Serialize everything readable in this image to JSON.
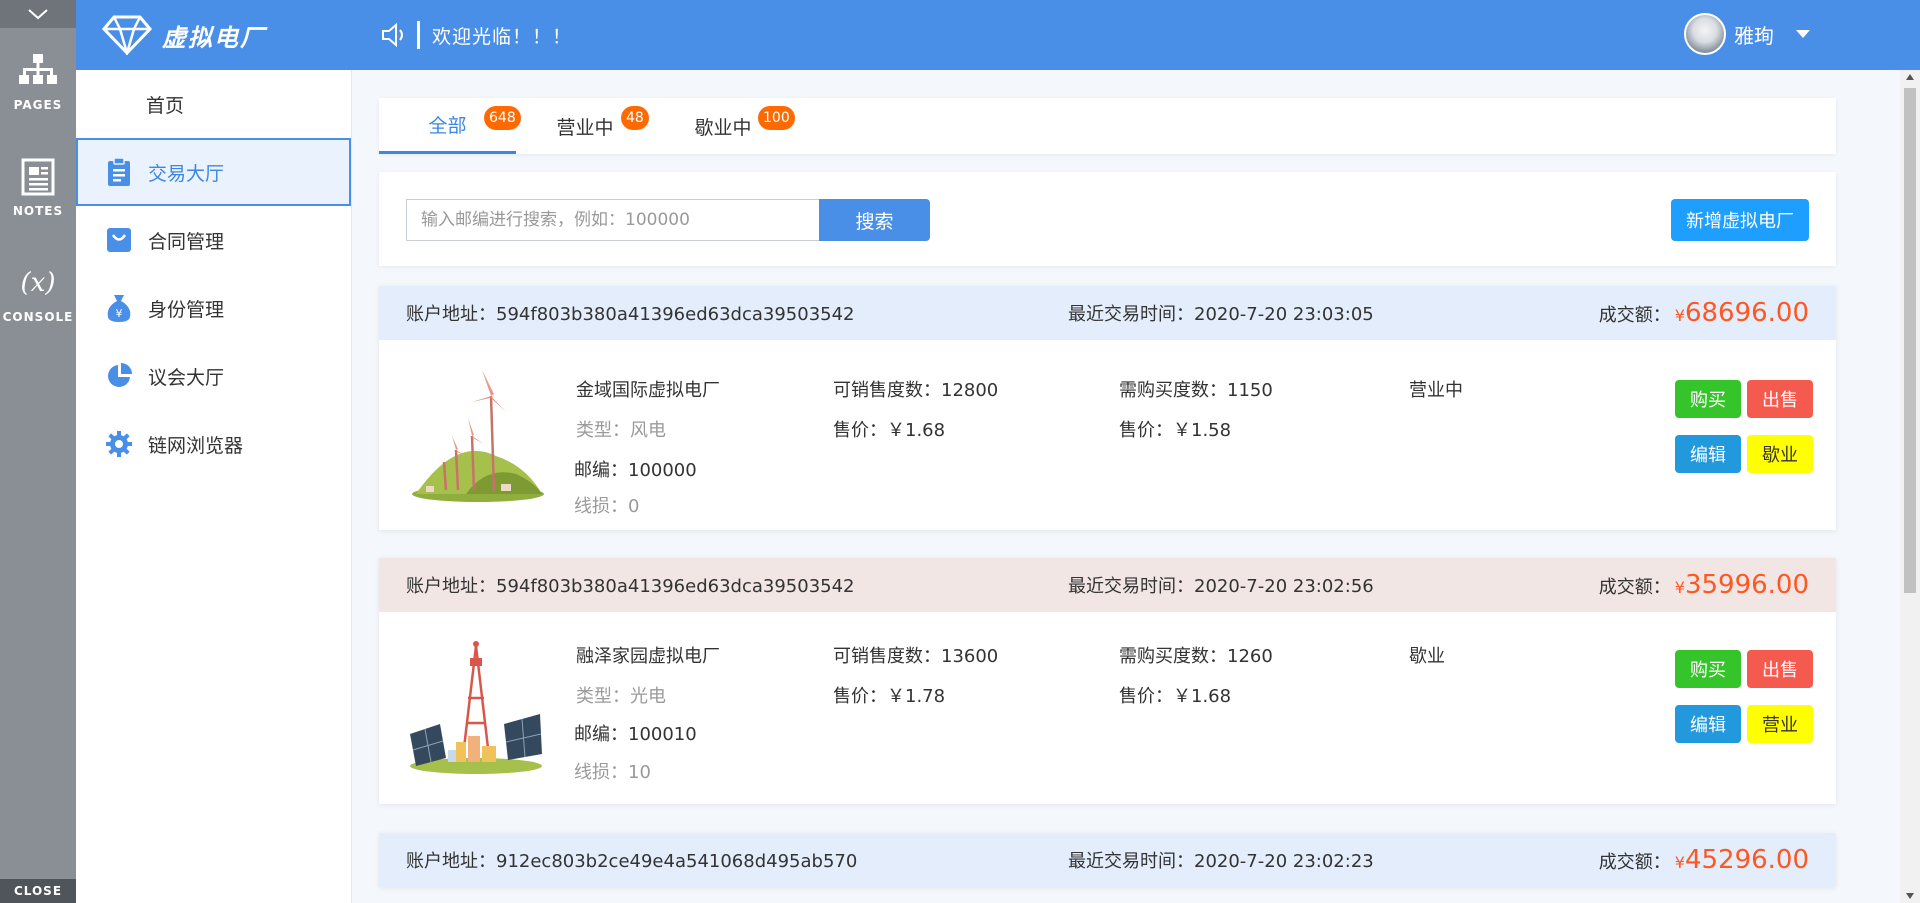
{
  "rail": {
    "items": [
      {
        "label": "PAGES"
      },
      {
        "label": "NOTES"
      },
      {
        "label": "CONSOLE"
      }
    ],
    "close_label": "CLOSE"
  },
  "header": {
    "brand": "虚拟电厂",
    "welcome": "欢迎光临！！！",
    "user_name": "雅珣"
  },
  "menu": {
    "items": [
      {
        "label": "首页"
      },
      {
        "label": "交易大厅"
      },
      {
        "label": "合同管理"
      },
      {
        "label": "身份管理"
      },
      {
        "label": "议会大厅"
      },
      {
        "label": "链网浏览器"
      }
    ]
  },
  "tabs": [
    {
      "label": "全部",
      "count": "648"
    },
    {
      "label": "营业中",
      "count": "48"
    },
    {
      "label": "歇业中",
      "count": "100"
    }
  ],
  "search": {
    "placeholder": "输入邮编进行搜索，例如：100000",
    "button": "搜索",
    "add_button": "新增虚拟电厂"
  },
  "cards": [
    {
      "address_label": "账户地址：",
      "address": "594f803b380a41396ed63dca39503542",
      "time_label": "最近交易时间：",
      "time": "2020-7-20 23:03:05",
      "amount_label": "成交额：",
      "currency": "¥",
      "amount": "68696.00",
      "name": "金域国际虚拟电厂",
      "type": "类型：风电",
      "zip": "邮编：100000",
      "loss": "线损：0",
      "sellable": "可销售度数：12800",
      "sell_price": "售价：￥1.68",
      "buy_need": "需购买度数：1150",
      "buy_price": "售价：￥1.58",
      "status": "营业中",
      "buttons": {
        "buy": "购买",
        "sell": "出售",
        "edit": "编辑",
        "toggle": "歇业"
      }
    },
    {
      "address_label": "账户地址：",
      "address": "594f803b380a41396ed63dca39503542",
      "time_label": "最近交易时间：",
      "time": "2020-7-20 23:02:56",
      "amount_label": "成交额：",
      "currency": "¥",
      "amount": "35996.00",
      "name": "融泽家园虚拟电厂",
      "type": "类型：光电",
      "zip": "邮编：100010",
      "loss": "线损：10",
      "sellable": "可销售度数：13600",
      "sell_price": "售价：￥1.78",
      "buy_need": "需购买度数：1260",
      "buy_price": "售价：￥1.68",
      "status": "歇业",
      "buttons": {
        "buy": "购买",
        "sell": "出售",
        "edit": "编辑",
        "toggle": "营业"
      }
    },
    {
      "address_label": "账户地址：",
      "address": "912ec803b2ce49e4a541068d495ab570",
      "time_label": "最近交易时间：",
      "time": "2020-7-20 23:02:23",
      "amount_label": "成交额：",
      "currency": "¥",
      "amount": "45296.00"
    }
  ],
  "colors": {
    "primary": "#4a8fe7",
    "header_row_blue": "#e3edfb",
    "header_row_pink": "#f1e6e4",
    "amount": "#ff5722",
    "badge": "#ff6a00"
  }
}
